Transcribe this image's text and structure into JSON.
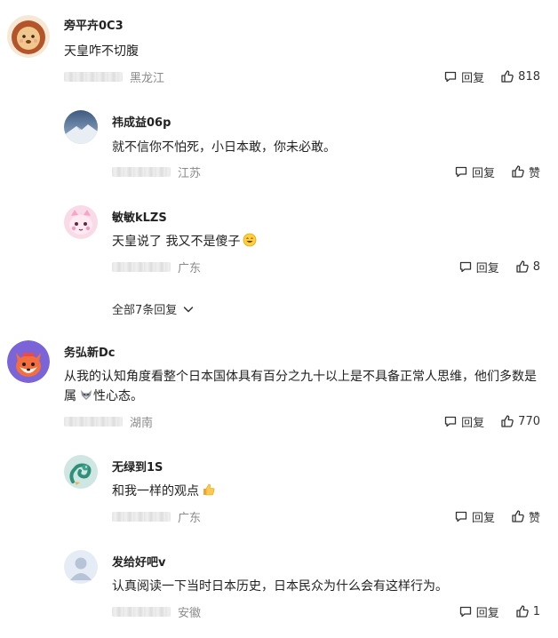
{
  "labels": {
    "reply": "回复",
    "like": "赞"
  },
  "comments": [
    {
      "user": "旁平卉0C3",
      "text": "天皇咋不切腹",
      "location": "黑龙江",
      "likes": "818",
      "avatar": "lion-avatar"
    },
    {
      "user": "务弘新Dc",
      "text": "从我的认知角度看整个日本国体具有百分之九十以上是不具备正常人思维，他们多数是属",
      "text_after_emoji": "性心态。",
      "location": "湖南",
      "likes": "770",
      "avatar": "fox-avatar"
    }
  ],
  "replies": [
    {
      "user": "祎成益06p",
      "text": "就不信你不怕死，小日本敢，你未必敢。",
      "location": "江苏",
      "likes": "赞",
      "avatar": "mountain-avatar"
    },
    {
      "user": "敏敏kLZS",
      "text": "天皇说了 我又不是傻子",
      "location": "广东",
      "likes": "8",
      "avatar": "pink-cat-avatar"
    },
    {
      "user": "无绿到1S",
      "text": "和我一样的观点",
      "location": "广东",
      "likes": "赞",
      "avatar": "dragon-avatar"
    },
    {
      "user": "发给好吧v",
      "text": "认真阅读一下当时日本历史，日本民众为什么会有这样行为。",
      "location": "安徽",
      "likes": "1",
      "avatar": "default-user-avatar"
    }
  ],
  "more_replies_label": "全部7条回复"
}
